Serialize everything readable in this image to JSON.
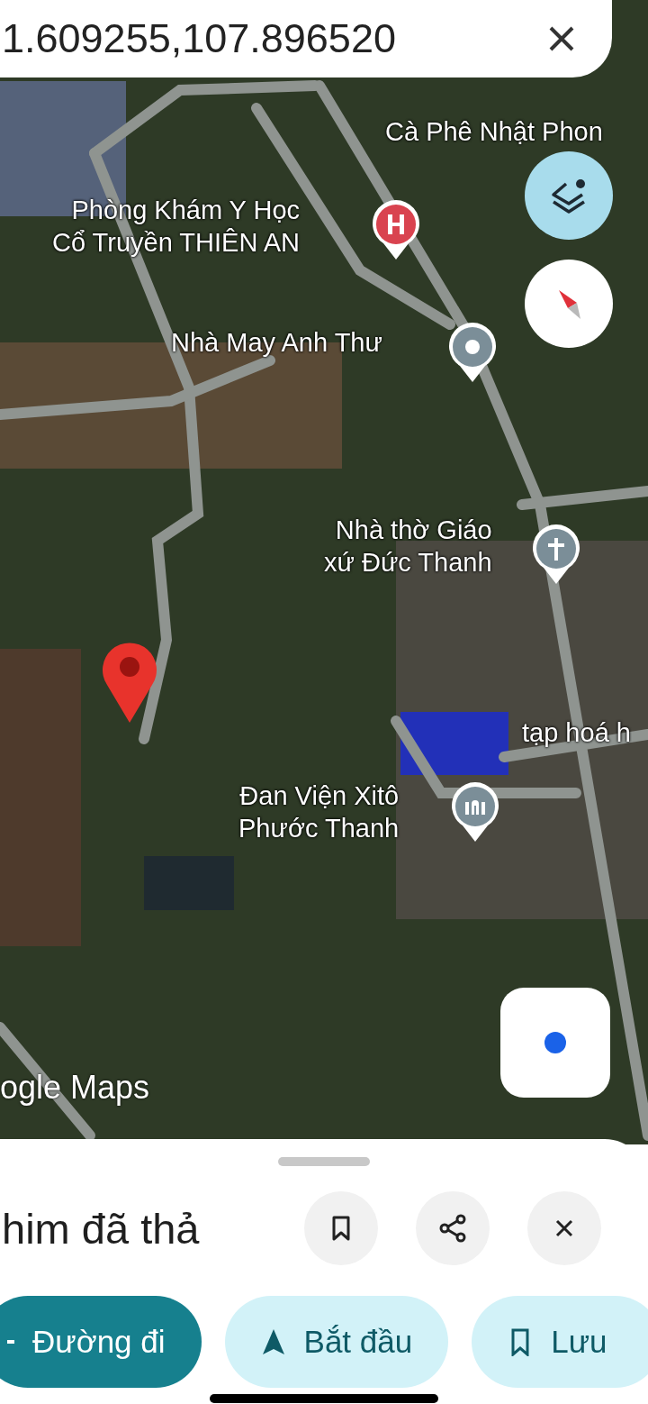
{
  "search_bar": {
    "value": "1.609255,107.896520"
  },
  "map": {
    "places": [
      {
        "kind": "label",
        "lines": [
          "Cà Phê Nhật Phon"
        ]
      },
      {
        "kind": "hospital",
        "lines": [
          "Phòng Khám Y Học",
          "Cổ Truyền THIÊN AN"
        ]
      },
      {
        "kind": "generic",
        "lines": [
          "Nhà May Anh Thư"
        ]
      },
      {
        "kind": "church",
        "lines": [
          "Nhà thờ Giáo",
          "xứ Đức Thanh"
        ]
      },
      {
        "kind": "label",
        "lines": [
          "tạp hoá h"
        ]
      },
      {
        "kind": "monastery",
        "lines": [
          "Đan Viện Xitô",
          "Phước Thanh"
        ]
      }
    ],
    "logo": "ogle Maps"
  },
  "sheet": {
    "title": "him đã thả",
    "actions": [
      {
        "kind": "directions",
        "label": "Đường đi",
        "selected": true
      },
      {
        "kind": "start",
        "label": "Bắt đầu",
        "selected": false
      },
      {
        "kind": "save",
        "label": "Lưu",
        "selected": false
      }
    ]
  }
}
